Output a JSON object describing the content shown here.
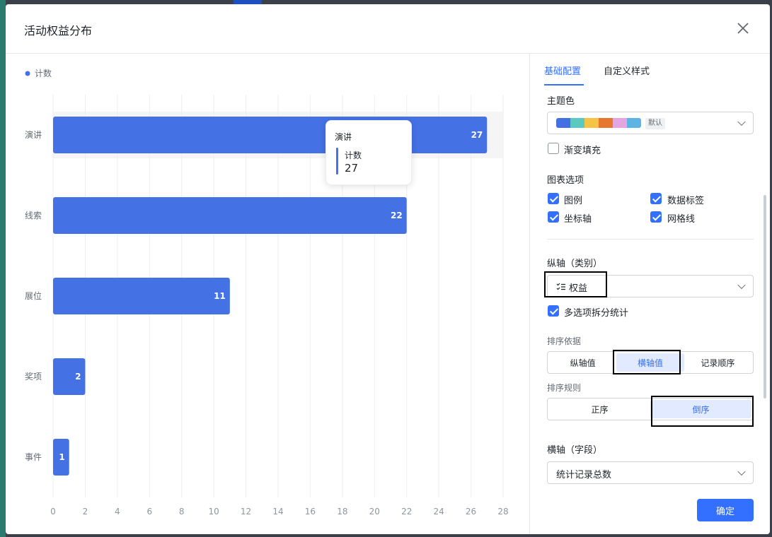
{
  "modal": {
    "title": "活动权益分布",
    "close_icon": "close-icon"
  },
  "tabs": [
    {
      "label": "基础配置",
      "active": true
    },
    {
      "label": "自定义样式",
      "active": false
    }
  ],
  "config": {
    "theme_color": {
      "label": "主题色",
      "swatches": [
        "#4470e4",
        "#5cc8c2",
        "#f6c445",
        "#e8772e",
        "#e4a5e0",
        "#5bb4e4"
      ],
      "default_badge": "默认"
    },
    "gradient_fill": {
      "label": "渐变填充",
      "checked": false
    },
    "chart_options": {
      "label": "图表选项",
      "items": [
        {
          "label": "图例",
          "checked": true
        },
        {
          "label": "数据标签",
          "checked": true
        },
        {
          "label": "坐标轴",
          "checked": true
        },
        {
          "label": "网格线",
          "checked": true
        }
      ]
    },
    "vertical_axis": {
      "label": "纵轴（类别）",
      "field_icon": "multi-select-field-icon",
      "value": "权益",
      "split_stats": {
        "label": "多选项拆分统计",
        "checked": true
      }
    },
    "sort_by": {
      "label": "排序依据",
      "options": [
        "纵轴值",
        "横轴值",
        "记录顺序"
      ],
      "selected": "横轴值"
    },
    "sort_rule": {
      "label": "排序规则",
      "options": [
        "正序",
        "倒序"
      ],
      "selected": "倒序"
    },
    "horizontal_axis": {
      "label": "横轴（字段）",
      "value": "统计记录总数"
    },
    "confirm_label": "确定"
  },
  "tooltip": {
    "title": "演讲",
    "series_name": "计数",
    "value": "27"
  },
  "chart_data": {
    "type": "bar",
    "orientation": "horizontal",
    "categories": [
      "演讲",
      "线索",
      "展位",
      "奖项",
      "事件"
    ],
    "series": [
      {
        "name": "计数",
        "values": [
          27,
          22,
          11,
          2,
          1
        ],
        "color": "#4471e4"
      }
    ],
    "xlim": [
      0,
      28
    ],
    "xticks": [
      0,
      2,
      4,
      6,
      8,
      10,
      12,
      14,
      16,
      18,
      20,
      22,
      24,
      26,
      28
    ],
    "grid": true,
    "legend": "top-left",
    "data_labels": true
  }
}
